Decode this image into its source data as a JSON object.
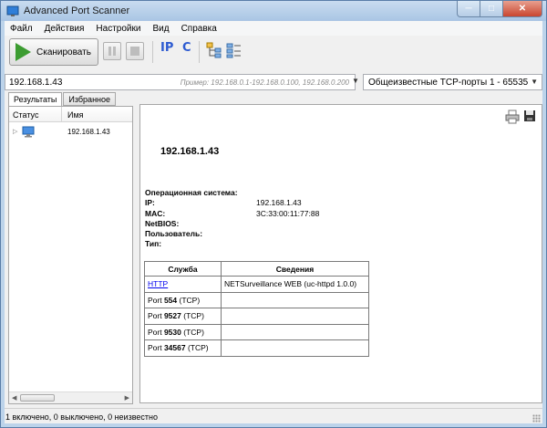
{
  "window": {
    "title": "Advanced Port Scanner"
  },
  "menu": [
    "Файл",
    "Действия",
    "Настройки",
    "Вид",
    "Справка"
  ],
  "toolbar": {
    "scan_label": "Сканировать",
    "ip_label": "IP",
    "c_label": "C"
  },
  "address": {
    "value": "192.168.1.43",
    "hint": "Пример: 192.168.0.1-192.168.0.100, 192.168.0.200"
  },
  "ports": {
    "selected": "Общеизвестные TCP-порты 1 - 65535"
  },
  "tabs": [
    "Результаты",
    "Избранное"
  ],
  "results": {
    "columns": {
      "status": "Статус",
      "name": "Имя"
    },
    "rows": [
      {
        "name": "192.168.1.43"
      }
    ]
  },
  "details": {
    "host": "192.168.1.43",
    "fields": [
      {
        "label": "Операционная система:",
        "value": ""
      },
      {
        "label": "IP:",
        "value": "192.168.1.43"
      },
      {
        "label": "MAC:",
        "value": "3C:33:00:11:77:88"
      },
      {
        "label": "NetBIOS:",
        "value": ""
      },
      {
        "label": "Пользователь:",
        "value": ""
      },
      {
        "label": "Тип:",
        "value": ""
      }
    ],
    "services_header": {
      "service": "Служба",
      "info": "Сведения"
    },
    "services": [
      {
        "prefix": "",
        "port": "",
        "proto": "",
        "link": "HTTP",
        "info": "NETSurveillance WEB (uc-httpd 1.0.0)"
      },
      {
        "prefix": "Port ",
        "port": "554",
        "proto": " (TCP)",
        "link": "",
        "info": ""
      },
      {
        "prefix": "Port ",
        "port": "9527",
        "proto": " (TCP)",
        "link": "",
        "info": ""
      },
      {
        "prefix": "Port ",
        "port": "9530",
        "proto": " (TCP)",
        "link": "",
        "info": ""
      },
      {
        "prefix": "Port ",
        "port": "34567",
        "proto": " (TCP)",
        "link": "",
        "info": ""
      }
    ]
  },
  "status": "1 включено, 0 выключено, 0 неизвестно"
}
